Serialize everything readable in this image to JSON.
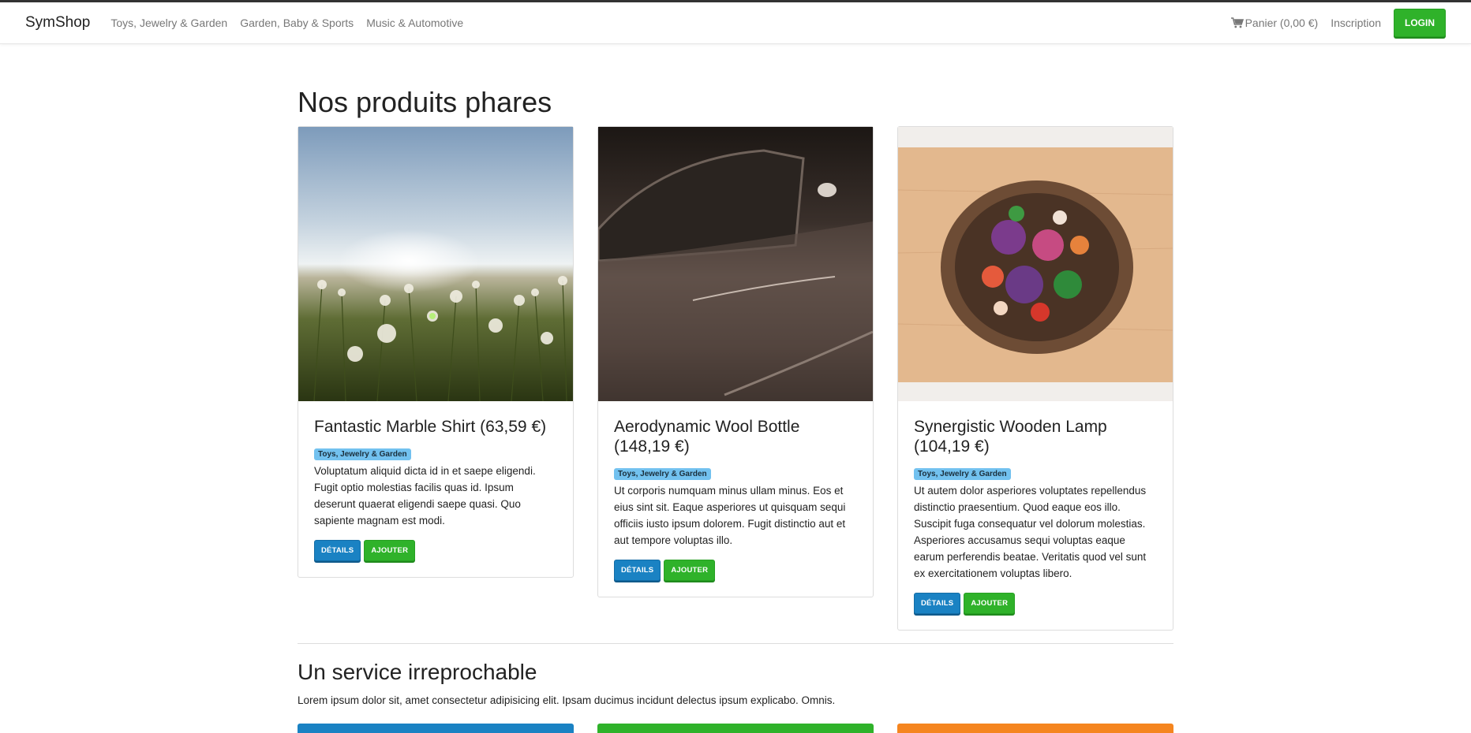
{
  "navbar": {
    "brand": "SymShop",
    "links": [
      "Toys, Jewelry & Garden",
      "Garden, Baby & Sports",
      "Music & Automotive"
    ],
    "cart_label": "Panier (0,00 €)",
    "signup_label": "Inscription",
    "login_label": "LOGIN"
  },
  "main": {
    "featured_title": "Nos produits phares",
    "products": [
      {
        "title": "Fantastic Marble Shirt (63,59 €)",
        "category": "Toys, Jewelry & Garden",
        "description": "Voluptatum aliquid dicta id in et saepe eligendi. Fugit optio molestias facilis quas id. Ipsum deserunt quaerat eligendi saepe quasi. Quo sapiente magnam est modi.",
        "details_label": "DÉTAILS",
        "add_label": "AJOUTER",
        "image": "dandelion-field-photo"
      },
      {
        "title": "Aerodynamic Wool Bottle (148,19 €)",
        "category": "Toys, Jewelry & Garden",
        "description": "Ut corporis numquam minus ullam minus. Eos et eius sint sit. Eaque asperiores ut quisquam sequi officiis iusto ipsum dolorem. Fugit distinctio aut et aut tempore voluptas illo.",
        "details_label": "DÉTAILS",
        "add_label": "AJOUTER",
        "image": "vintage-car-photo"
      },
      {
        "title": "Synergistic Wooden Lamp (104,19 €)",
        "category": "Toys, Jewelry & Garden",
        "description": "Ut autem dolor asperiores voluptates repellendus distinctio praesentium. Quod eaque eos illo. Suscipit fuga consequatur vel dolorum molestias. Asperiores accusamus sequi voluptas eaque earum perferendis beatae. Veritatis quod vel sunt ex exercitationem voluptas libero.",
        "details_label": "DÉTAILS",
        "add_label": "AJOUTER",
        "image": "salad-bowl-photo"
      }
    ],
    "service_title": "Un service irreprochable",
    "service_text": "Lorem ipsum dolor sit, amet consectetur adipisicing elit. Ipsam ducimus incidunt delectus ipsum explicabo. Omnis.",
    "service_panel_colors": [
      "#1a82c3",
      "#2fb22a",
      "#f5851f"
    ]
  },
  "colors": {
    "primary": "#1a82c3",
    "success": "#2fb22a",
    "warning": "#f5851f",
    "badge": "#72c1ef"
  }
}
